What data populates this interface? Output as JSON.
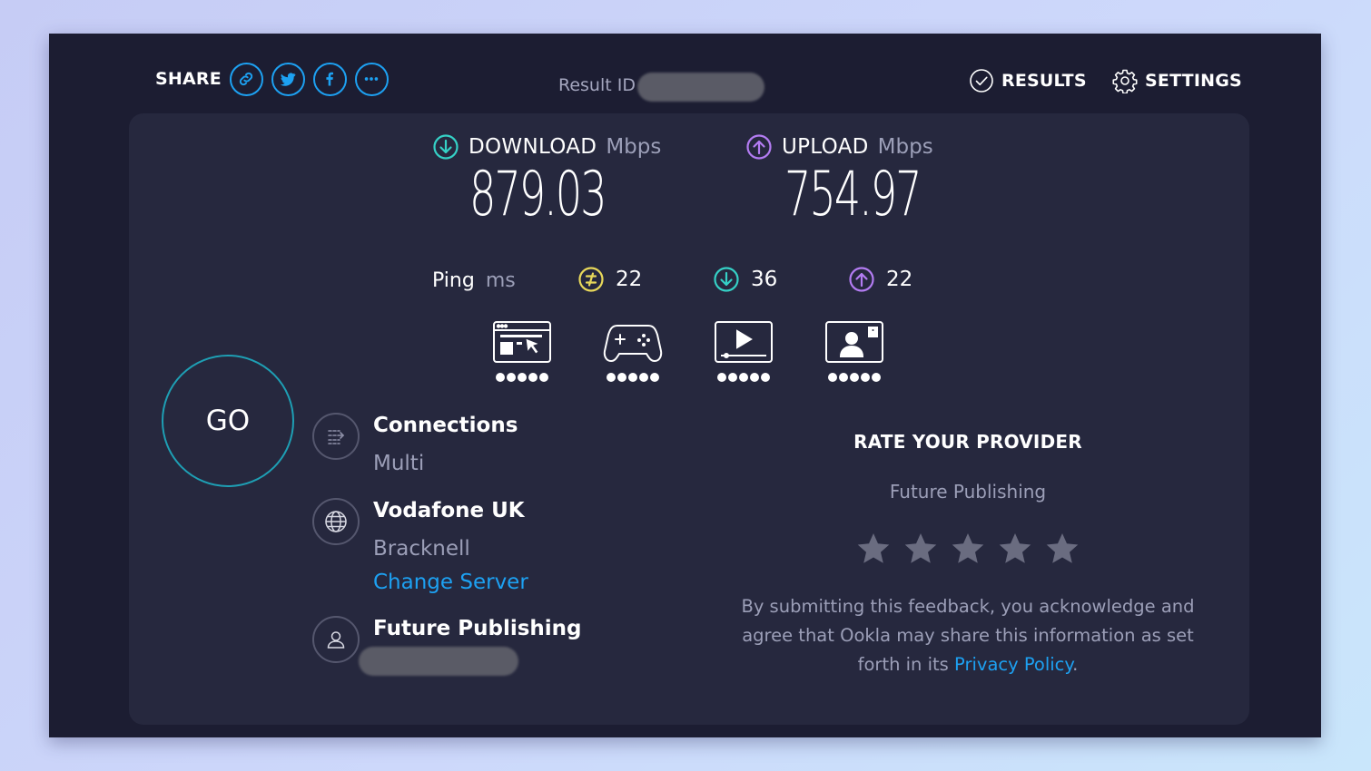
{
  "header": {
    "share_label": "SHARE",
    "share_buttons": [
      "link-icon",
      "twitter-icon",
      "facebook-icon",
      "more-icon"
    ],
    "result_id_label": "Result ID",
    "results_label": "RESULTS",
    "settings_label": "SETTINGS"
  },
  "metrics": {
    "download": {
      "label": "DOWNLOAD",
      "unit": "Mbps",
      "value": "879.03"
    },
    "upload": {
      "label": "UPLOAD",
      "unit": "Mbps",
      "value": "754.97"
    }
  },
  "ping": {
    "label": "Ping",
    "unit": "ms",
    "idle": "22",
    "download": "36",
    "upload": "22"
  },
  "usecases": [
    {
      "icon": "web-browsing-icon",
      "rating": 5
    },
    {
      "icon": "gaming-icon",
      "rating": 5
    },
    {
      "icon": "video-streaming-icon",
      "rating": 5
    },
    {
      "icon": "video-chat-icon",
      "rating": 5
    }
  ],
  "go_label": "GO",
  "connections": {
    "title": "Connections",
    "value": "Multi"
  },
  "server": {
    "name": "Vodafone UK",
    "location": "Bracknell",
    "change_label": "Change Server"
  },
  "provider": {
    "name": "Future Publishing"
  },
  "rate": {
    "title": "RATE YOUR PROVIDER",
    "provider": "Future Publishing",
    "disclaimer": "By submitting this feedback, you acknowledge and agree that Ookla may share this information as set forth in its ",
    "privacy_label": "Privacy Policy",
    "period": "."
  },
  "colors": {
    "download": "#35d1c6",
    "upload": "#b37cf2",
    "idle": "#e8d85a",
    "accent": "#1da1f2",
    "go_ring": "#1e9fb4"
  }
}
